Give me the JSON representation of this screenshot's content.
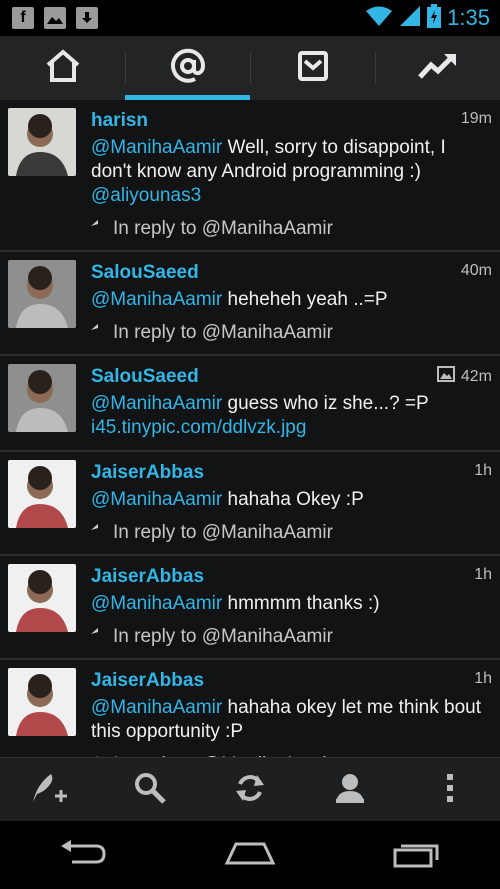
{
  "status": {
    "time": "1:35"
  },
  "tabs": [
    {
      "icon": "home-icon"
    },
    {
      "icon": "at-icon",
      "active": true
    },
    {
      "icon": "mail-icon"
    },
    {
      "icon": "trending-icon"
    }
  ],
  "tweets": [
    {
      "user": "harisn",
      "age": "19m",
      "mention": "@ManihaAamir",
      "text": " Well, sorry to disappoint, I don't know any Android programming :)",
      "extra": "@aliyounas3",
      "reply": "In reply to @ManihaAamir",
      "has_image": false
    },
    {
      "user": "SalouSaeed",
      "age": "40m",
      "mention": "@ManihaAamir",
      "text": " heheheh yeah ..=P",
      "extra": "",
      "reply": "In reply to @ManihaAamir",
      "has_image": false
    },
    {
      "user": "SalouSaeed",
      "age": "42m",
      "mention": "@ManihaAamir",
      "text": " guess who iz she...? =P",
      "extra": "i45.tinypic.com/ddlvzk.jpg",
      "reply": "",
      "has_image": true
    },
    {
      "user": "JaiserAbbas",
      "age": "1h",
      "mention": "@ManihaAamir",
      "text": " hahaha Okey :P",
      "extra": "",
      "reply": "In reply to @ManihaAamir",
      "has_image": false
    },
    {
      "user": "JaiserAbbas",
      "age": "1h",
      "mention": "@ManihaAamir",
      "text": " hmmmm thanks :)",
      "extra": "",
      "reply": "In reply to @ManihaAamir",
      "has_image": false
    },
    {
      "user": "JaiserAbbas",
      "age": "1h",
      "mention": "@ManihaAamir",
      "text": " hahaha okey let me think bout this opportunity :P",
      "extra": "",
      "reply": "In reply to @ManihaAamir",
      "has_image": false
    }
  ],
  "toolbar": [
    {
      "icon": "compose-icon"
    },
    {
      "icon": "search-icon"
    },
    {
      "icon": "refresh-icon"
    },
    {
      "icon": "profile-icon"
    },
    {
      "icon": "overflow-menu-icon"
    }
  ],
  "colors": {
    "accent": "#33b5e5",
    "background": "#121314"
  }
}
